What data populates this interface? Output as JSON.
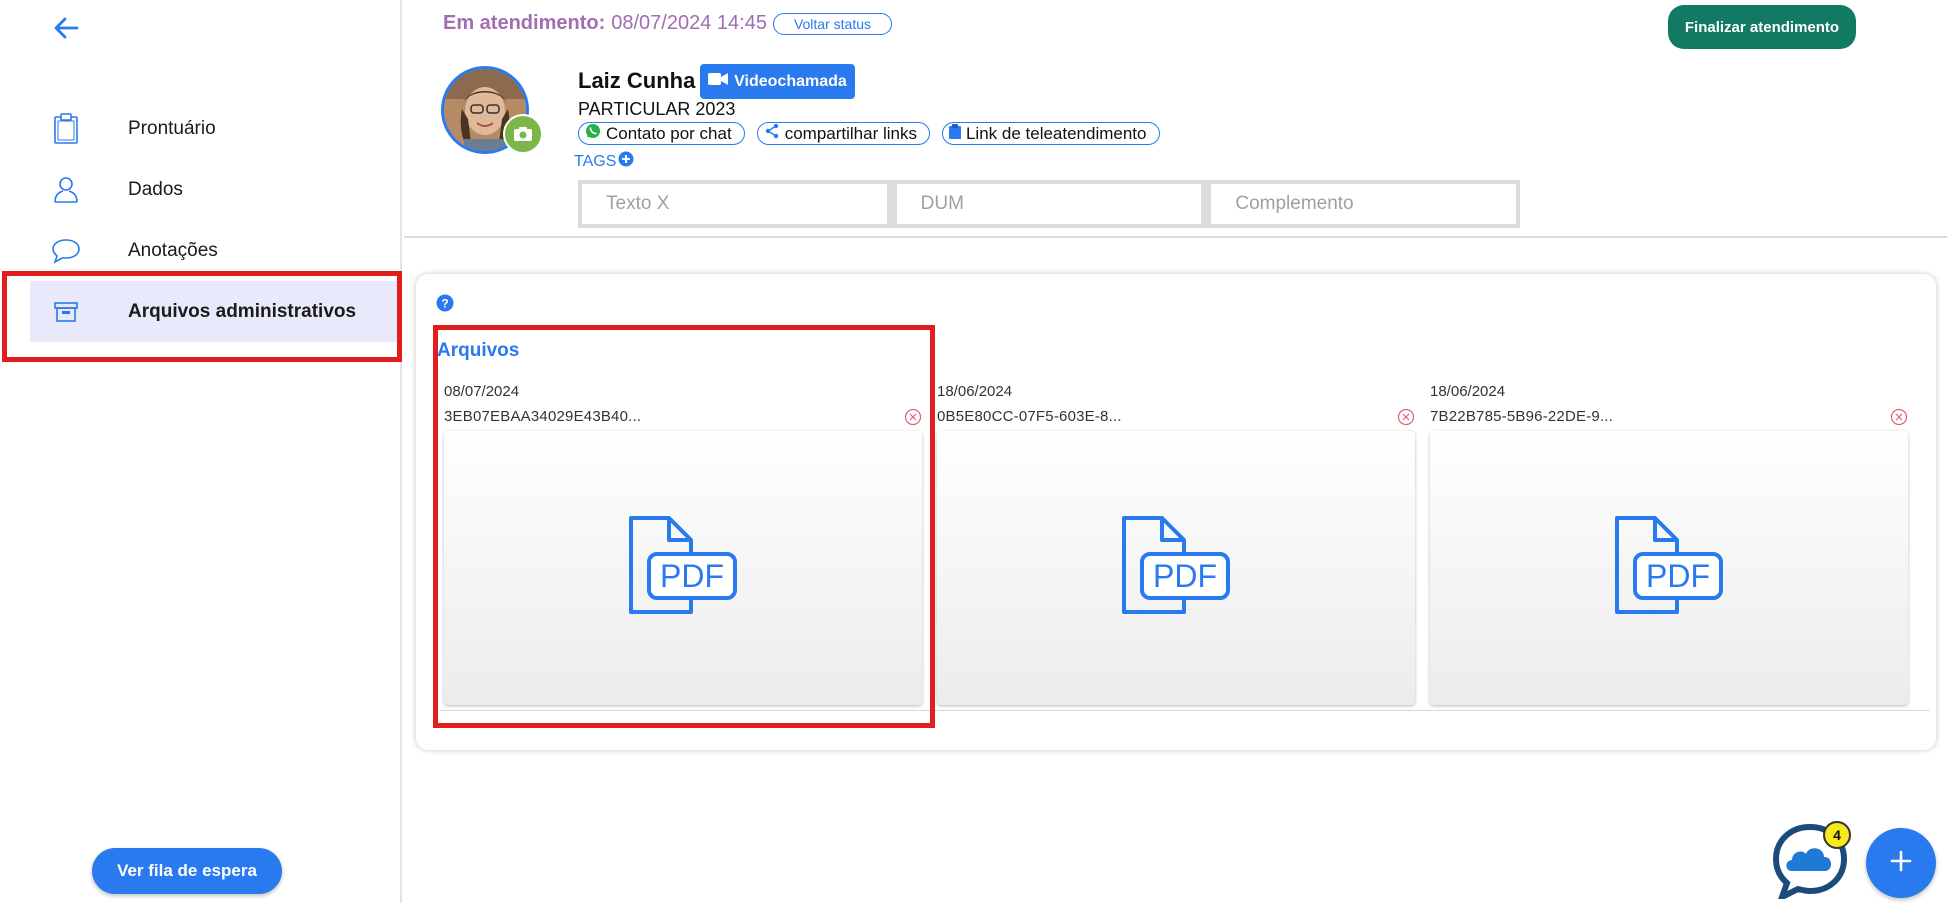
{
  "sidebar": {
    "items": [
      {
        "label": "Prontuário",
        "icon": "clipboard-icon"
      },
      {
        "label": "Dados",
        "icon": "user-icon"
      },
      {
        "label": "Anotações",
        "icon": "chat-bubble-icon"
      },
      {
        "label": "Arquivos administrativos",
        "icon": "archive-box-icon",
        "active": true
      }
    ],
    "queue_button": "Ver fila de espera"
  },
  "header": {
    "status_label": "Em atendimento:",
    "status_time": "08/07/2024 14:45",
    "voltar_status": "Voltar status",
    "finalizar": "Finalizar atendimento",
    "patient_name": "Laiz Cunha",
    "video_button": "Videochamada",
    "plan": "PARTICULAR 2023",
    "pills": [
      {
        "label": "Contato por chat",
        "icon": "whatsapp-icon"
      },
      {
        "label": "compartilhar links",
        "icon": "share-icon"
      },
      {
        "label": "Link de teleatendimento",
        "icon": "clipboard-icon"
      }
    ],
    "tags_label": "TAGS",
    "fields": [
      {
        "placeholder": "Texto X"
      },
      {
        "placeholder": "DUM"
      },
      {
        "placeholder": "Complemento"
      }
    ]
  },
  "files_section": {
    "title": "Arquivos",
    "files": [
      {
        "date": "08/07/2024",
        "name": "3EB07EBAA34029E43B40...",
        "type": "PDF"
      },
      {
        "date": "18/06/2024",
        "name": "0B5E80CC-07F5-603E-8...",
        "type": "PDF"
      },
      {
        "date": "18/06/2024",
        "name": "7B22B785-5B96-22DE-9...",
        "type": "PDF"
      }
    ]
  },
  "chat_badge_count": "4",
  "colors": {
    "primary": "#2979ef",
    "finalizar": "#127a63",
    "status_purple": "#a36db3",
    "highlight_red": "#e31c1c",
    "active_nav": "#e8e9fb"
  }
}
